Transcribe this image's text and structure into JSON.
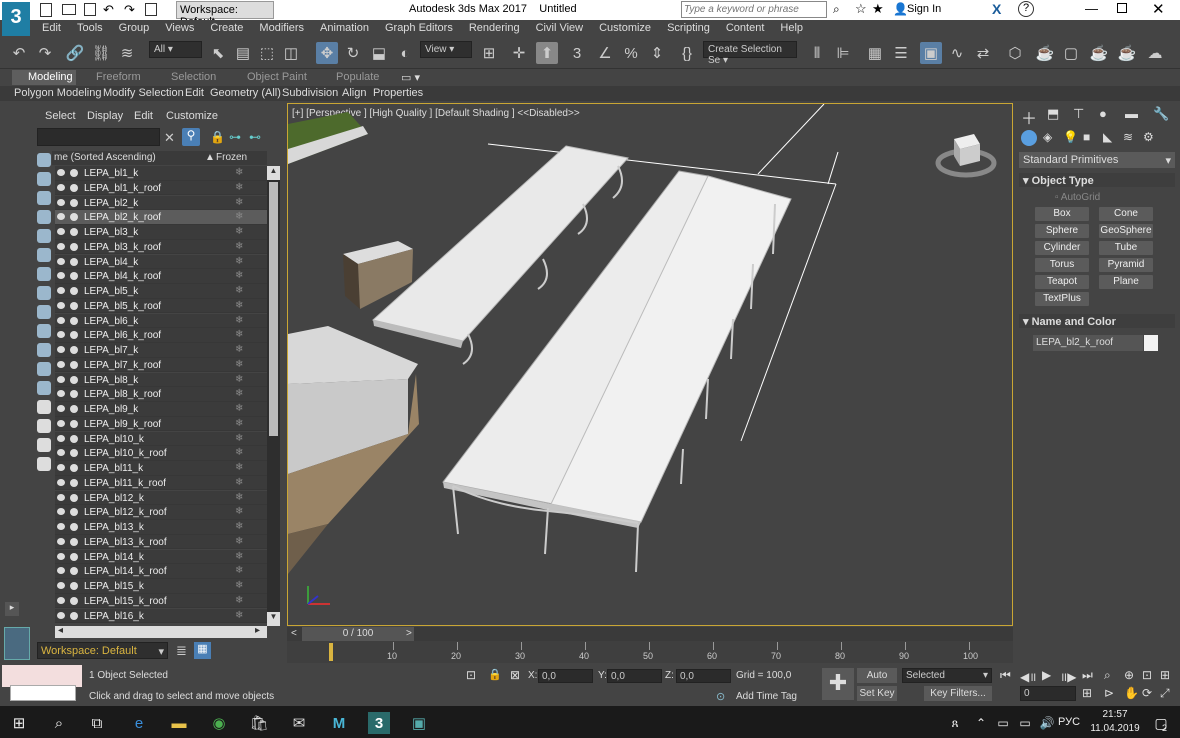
{
  "window": {
    "title": "Autodesk 3ds Max 2017",
    "file": "Untitled",
    "workspace": "Workspace: Default",
    "search_placeholder": "Type a keyword or phrase",
    "sign_in": "Sign In"
  },
  "menu": [
    "Edit",
    "Tools",
    "Group",
    "Views",
    "Create",
    "Modifiers",
    "Animation",
    "Graph Editors",
    "Rendering",
    "Civil View",
    "Customize",
    "Scripting",
    "Content",
    "Help"
  ],
  "toolbar": {
    "selection_filter": "All",
    "ref_coord": "View",
    "named_selection": "Create Selection Se"
  },
  "ribbon": {
    "tabs": [
      "Modeling",
      "Freeform",
      "Selection",
      "Object Paint",
      "Populate"
    ],
    "subtabs": [
      "Polygon Modeling",
      "Modify Selection",
      "Edit",
      "Geometry (All)",
      "Subdivision",
      "Align",
      "Properties"
    ]
  },
  "explorer": {
    "menus": [
      "Select",
      "Display",
      "Edit",
      "Customize"
    ],
    "col_name": "me (Sorted Ascending)",
    "col_frozen": "Frozen",
    "items": [
      "LEPA_bl1_k",
      "LEPA_bl1_k_roof",
      "LEPA_bl2_k",
      "LEPA_bl2_k_roof",
      "LEPA_bl3_k",
      "LEPA_bl3_k_roof",
      "LEPA_bl4_k",
      "LEPA_bl4_k_roof",
      "LEPA_bl5_k",
      "LEPA_bl5_k_roof",
      "LEPA_bl6_k",
      "LEPA_bl6_k_roof",
      "LEPA_bl7_k",
      "LEPA_bl7_k_roof",
      "LEPA_bl8_k",
      "LEPA_bl8_k_roof",
      "LEPA_bl9_k",
      "LEPA_bl9_k_roof",
      "LEPA_bl10_k",
      "LEPA_bl10_k_roof",
      "LEPA_bl11_k",
      "LEPA_bl11_k_roof",
      "LEPA_bl12_k",
      "LEPA_bl12_k_roof",
      "LEPA_bl13_k",
      "LEPA_bl13_k_roof",
      "LEPA_bl14_k",
      "LEPA_bl14_k_roof",
      "LEPA_bl15_k",
      "LEPA_bl15_k_roof",
      "LEPA_bl16_k"
    ],
    "selected_index": 3,
    "workspace": "Workspace: Default"
  },
  "viewport": {
    "label": "[+] [Perspective ] [High Quality ] [Default Shading ]  <<Disabled>>"
  },
  "command_panel": {
    "dropdown": "Standard Primitives",
    "section_object_type": "Object Type",
    "autogrid": "AutoGrid",
    "buttons": [
      "Box",
      "Cone",
      "Sphere",
      "GeoSphere",
      "Cylinder",
      "Tube",
      "Torus",
      "Pyramid",
      "Teapot",
      "Plane",
      "TextPlus"
    ],
    "section_name_color": "Name and Color",
    "object_name": "LEPA_bl2_k_roof"
  },
  "timeline": {
    "frame": "0 / 100",
    "ticks": [
      "10",
      "20",
      "30",
      "40",
      "50",
      "60",
      "70",
      "80",
      "90",
      "100"
    ]
  },
  "status": {
    "selected": "1 Object Selected",
    "prompt": "Click and drag to select and move objects",
    "x_label": "X:",
    "x": "0,0",
    "y_label": "Y:",
    "y": "0,0",
    "z_label": "Z:",
    "z": "0,0",
    "grid": "Grid = 100,0",
    "add_time_tag": "Add Time Tag",
    "auto_key": "Auto Key",
    "set_key": "Set Key",
    "key_mode": "Selected",
    "key_filters": "Key Filters...",
    "frame_field": "0"
  },
  "taskbar": {
    "lang": "РУС",
    "time": "21:57",
    "date": "11.04.2019",
    "notif": "2"
  }
}
